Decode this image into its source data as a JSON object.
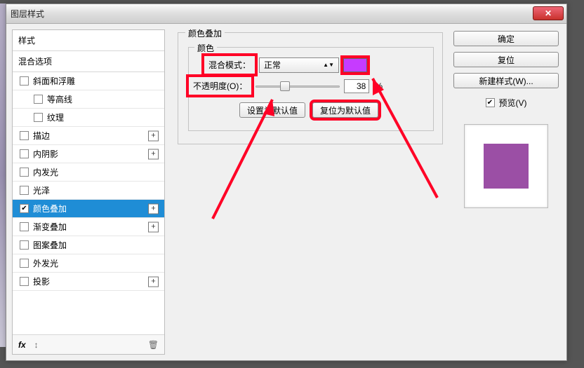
{
  "window": {
    "title": "图层样式"
  },
  "styles": {
    "header": "样式",
    "blending_options": "混合选项",
    "items": [
      {
        "label": "斜面和浮雕",
        "checked": false,
        "indent": false,
        "plus": false
      },
      {
        "label": "等高线",
        "checked": false,
        "indent": true,
        "plus": false
      },
      {
        "label": "纹理",
        "checked": false,
        "indent": true,
        "plus": false
      },
      {
        "label": "描边",
        "checked": false,
        "indent": false,
        "plus": true
      },
      {
        "label": "内阴影",
        "checked": false,
        "indent": false,
        "plus": true
      },
      {
        "label": "内发光",
        "checked": false,
        "indent": false,
        "plus": false
      },
      {
        "label": "光泽",
        "checked": false,
        "indent": false,
        "plus": false
      },
      {
        "label": "颜色叠加",
        "checked": true,
        "indent": false,
        "plus": true,
        "selected": true
      },
      {
        "label": "渐变叠加",
        "checked": false,
        "indent": false,
        "plus": true
      },
      {
        "label": "图案叠加",
        "checked": false,
        "indent": false,
        "plus": false
      },
      {
        "label": "外发光",
        "checked": false,
        "indent": false,
        "plus": false
      },
      {
        "label": "投影",
        "checked": false,
        "indent": false,
        "plus": true
      }
    ],
    "footer_fx": "fx"
  },
  "center": {
    "section_title": "颜色叠加",
    "color_group": "颜色",
    "blend_mode_label": "混合模式：",
    "blend_mode_value": "正常",
    "opacity_label": "不透明度(O)：",
    "opacity_value": "38",
    "percent": "%",
    "set_default": "设置为默认值",
    "reset_default": "复位为默认值",
    "overlay_color": "#c63bff"
  },
  "right": {
    "ok": "确定",
    "cancel": "复位",
    "new_style": "新建样式(W)...",
    "preview_label": "预览(V)",
    "preview_checked": true,
    "preview_color": "#9b4fa5"
  }
}
